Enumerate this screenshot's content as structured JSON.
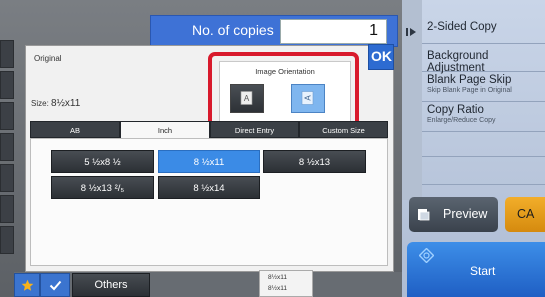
{
  "header": {
    "copies_label": "No. of copies",
    "copies_value": "1"
  },
  "dialog": {
    "title": "Original",
    "size_label": "Size:",
    "size_value": "8½x11",
    "ok_label": "OK",
    "orientation": {
      "title": "Image Orientation",
      "selected": "landscape"
    },
    "tabs": [
      {
        "label": "AB",
        "active": false
      },
      {
        "label": "Inch",
        "active": true
      },
      {
        "label": "Direct Entry",
        "active": false
      },
      {
        "label": "Custom Size",
        "active": false
      }
    ],
    "sizes": [
      {
        "label": "5 ½x8 ½",
        "selected": false
      },
      {
        "label": "8 ½x11",
        "selected": true
      },
      {
        "label": "8 ½x13",
        "selected": false
      },
      {
        "label": "8 ½x13 ²/₅",
        "selected": false
      },
      {
        "label": "8 ½x14",
        "selected": false
      }
    ]
  },
  "right_menu": {
    "items": [
      {
        "title": "2-Sided Copy",
        "subtitle": ""
      },
      {
        "title": "Background Adjustment",
        "subtitle": ""
      },
      {
        "title": "Blank Page Skip",
        "subtitle": "Skip Blank Page in Original"
      },
      {
        "title": "Copy Ratio",
        "subtitle": "Enlarge/Reduce Copy"
      }
    ],
    "preview_label": "Preview",
    "ca_label": "CA",
    "start_label": "Start"
  },
  "bottom": {
    "others_label": "Others",
    "tray_lines": [
      "8½x11",
      "8½x11"
    ]
  },
  "colors": {
    "accent_blue": "#3e72d6",
    "selected_blue": "#3b8be6",
    "highlight_red": "#d81a2c",
    "ca_orange": "#f2ae2a",
    "start_blue": "#2f7ad8"
  }
}
